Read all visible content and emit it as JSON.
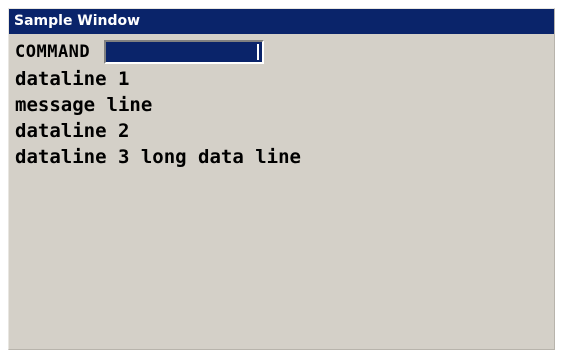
{
  "window": {
    "title": "Sample Window"
  },
  "command": {
    "label": "COMMAND",
    "value": ""
  },
  "lines": [
    "dataline 1",
    "message line",
    "dataline 2",
    "dataline 3 long data line"
  ]
}
